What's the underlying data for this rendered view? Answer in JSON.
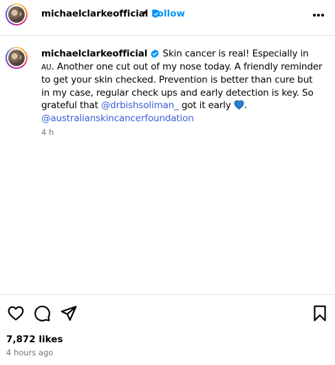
{
  "header": {
    "username": "michaelclarkeofficial",
    "separator": "•",
    "follow_label": "Follow"
  },
  "caption": {
    "username": "michaelclarkeofficial",
    "text_1": " Skin cancer is real! Especially in ",
    "au_flag": "AU",
    "text_2": ". Another one cut out of my nose today. A friendly reminder to get your skin checked. Prevention is better than cure but in my case, regular check ups and early detection is key. So grateful that ",
    "mention_1": "@drbishsoliman_",
    "text_3": " got it early ",
    "text_4": ".",
    "mention_2": "@australianskincancerfoundation",
    "time": "4 h"
  },
  "footer": {
    "likes": "7,872 likes",
    "time_ago": "4 hours ago"
  },
  "icons": {
    "verified": "verified-badge-icon",
    "more": "more-options-icon",
    "like": "heart-icon",
    "comment": "comment-icon",
    "share": "share-icon",
    "save": "bookmark-icon",
    "emoji": "blue-heart-emoji"
  },
  "colors": {
    "follow": "#0095f6",
    "mention": "#3b5cd9",
    "verified": "#0095f6",
    "muted": "#737373"
  }
}
